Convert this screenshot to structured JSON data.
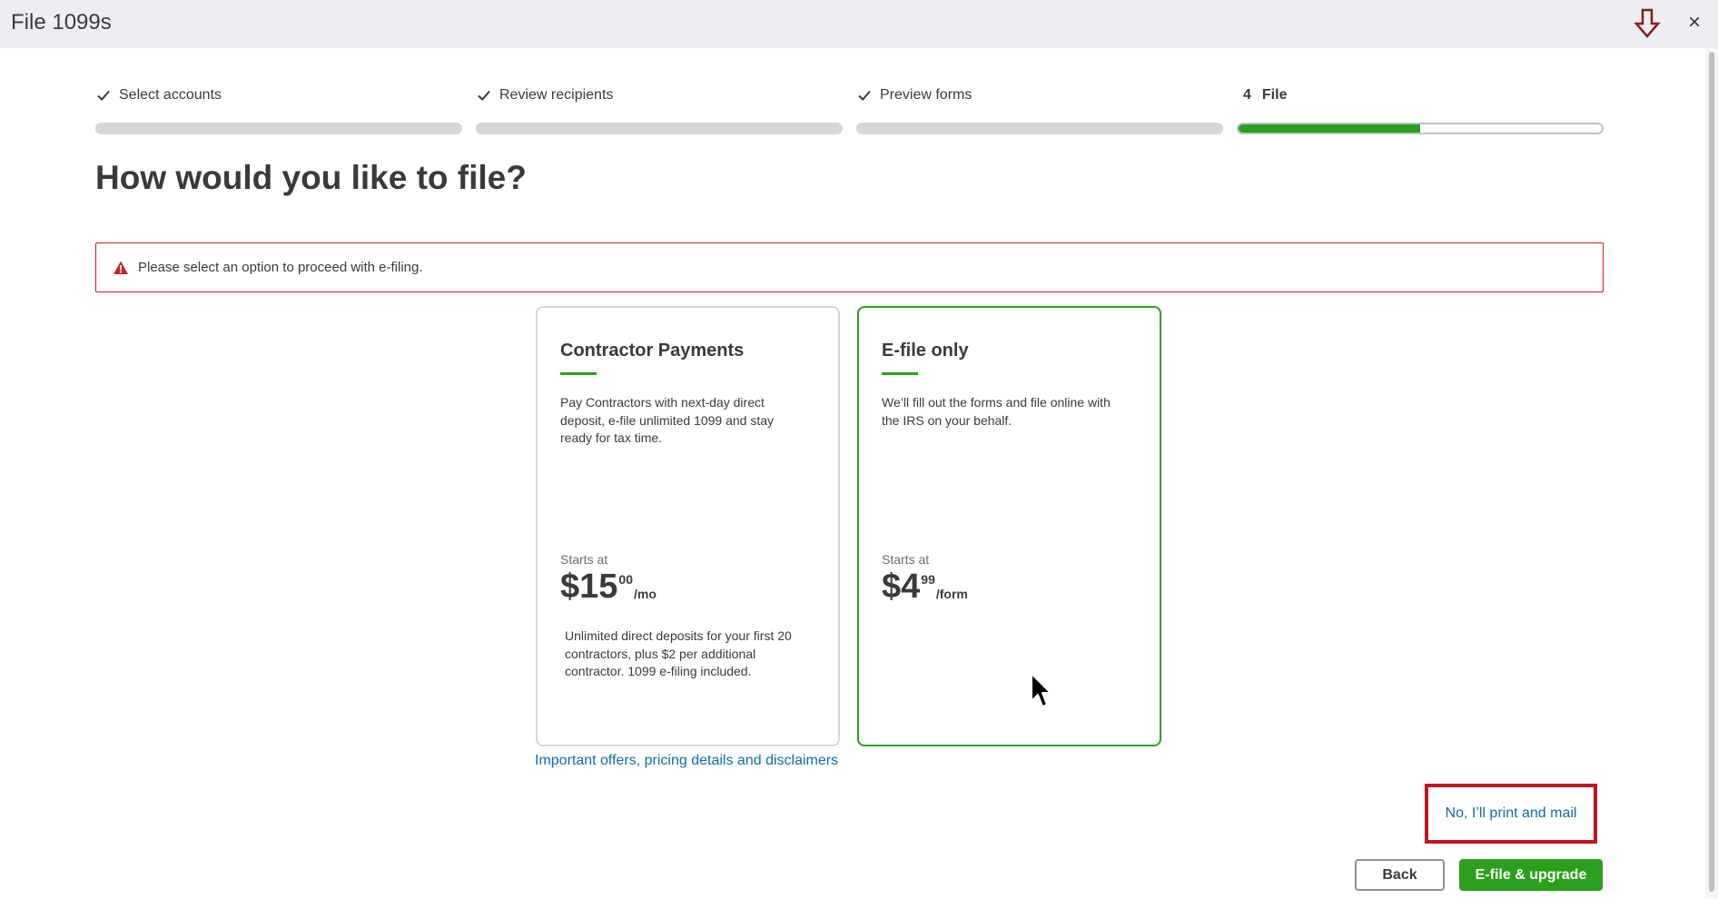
{
  "window": {
    "title": "File 1099s",
    "download_icon": "download-arrow-icon",
    "close_label": "×"
  },
  "steps": [
    {
      "label": "Select accounts",
      "status": "complete",
      "icon": "check-icon"
    },
    {
      "label": "Review recipients",
      "status": "complete",
      "icon": "check-icon"
    },
    {
      "label": "Preview forms",
      "status": "complete",
      "icon": "check-icon"
    },
    {
      "number": "4",
      "label": "File",
      "status": "active",
      "progress": 0.5
    }
  ],
  "main": {
    "heading": "How would you like to file?",
    "alert": {
      "icon": "warning-icon",
      "text": "Please select an option to proceed with e-filing."
    }
  },
  "cards": [
    {
      "title": "Contractor Payments",
      "description": "Pay Contractors with next-day direct deposit, e-file unlimited 1099 and stay ready for tax time.",
      "starts_at": "Starts at",
      "price_main": "$15",
      "price_cents": "00",
      "price_unit": "/mo",
      "note": "Unlimited direct deposits for your first 20 contractors, plus $2 per additional contractor. 1099 e-filing included.",
      "selected": false
    },
    {
      "title": "E-file only",
      "description": "We’ll fill out the forms and file online with the IRS on your behalf.",
      "starts_at": "Starts at",
      "price_main": "$4",
      "price_cents": "99",
      "price_unit": "/form",
      "selected": true
    }
  ],
  "links": {
    "offers": "Important offers, pricing details and disclaimers",
    "print_mail": "No, I’ll print and mail"
  },
  "footer": {
    "back_label": "Back",
    "efile_label": "E-file & upgrade"
  },
  "colors": {
    "accent_green": "#2ca01c",
    "link_blue": "#0d6fa8",
    "alert_red": "#c9202a",
    "highlight_red": "#c11421"
  }
}
